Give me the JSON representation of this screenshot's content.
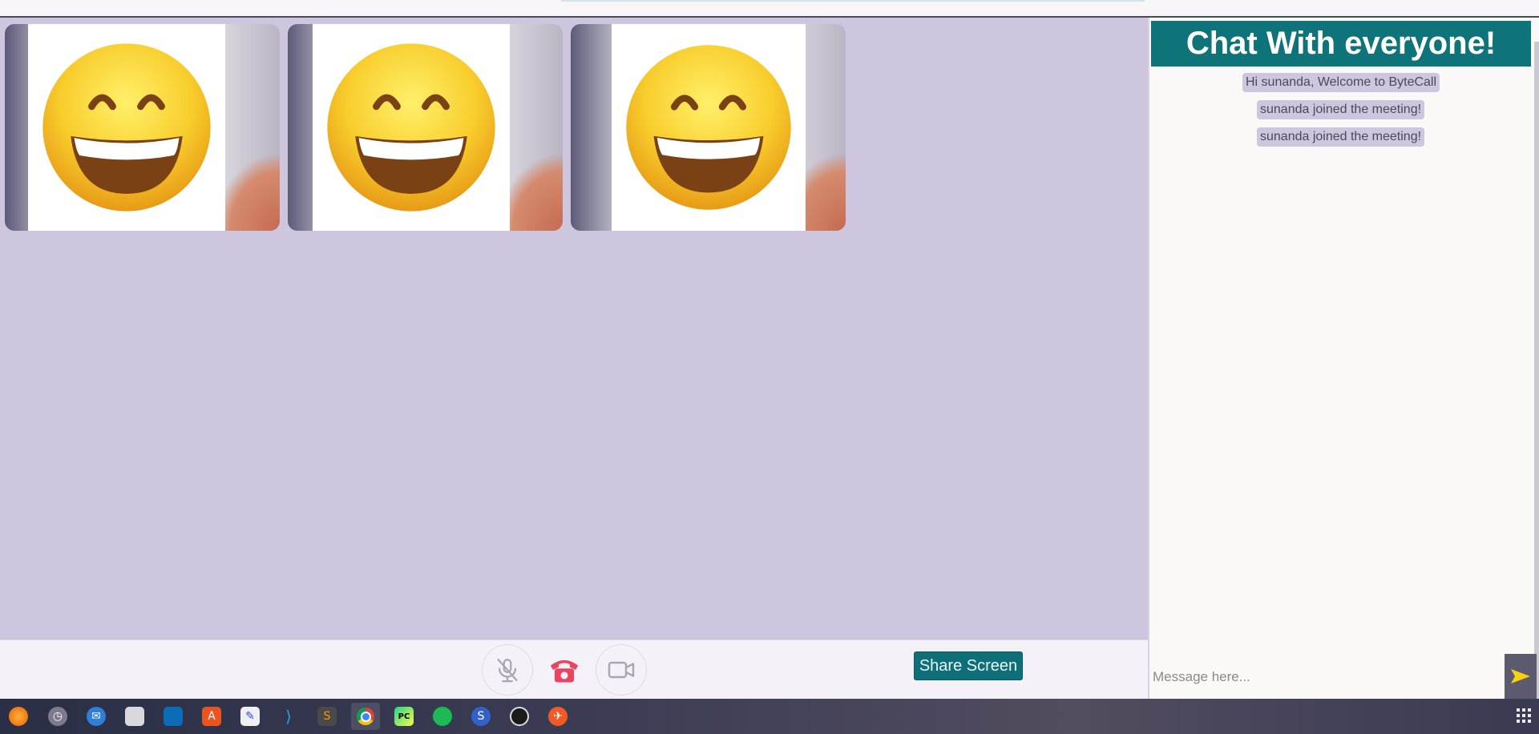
{
  "chat": {
    "header": "Chat With everyone!",
    "messages": [
      {
        "text": "Hi sunanda, Welcome to ByteCall"
      },
      {
        "text": "sunanda joined the meeting!"
      },
      {
        "text": "sunanda joined the meeting!"
      }
    ],
    "input_placeholder": "Message here...",
    "send_icon": "send-arrow-icon"
  },
  "video_grid": {
    "tiles": [
      {
        "avatar": "grinning-face-emoji"
      },
      {
        "avatar": "grinning-face-emoji"
      },
      {
        "avatar": "grinning-face-emoji"
      }
    ]
  },
  "controls": {
    "mic_icon": "microphone-muted-icon",
    "hangup_icon": "phone-hangup-icon",
    "camera_icon": "video-camera-icon",
    "share_label": "Share Screen"
  },
  "taskbar": {
    "apps": [
      "firefox",
      "clock",
      "thunderbird",
      "files",
      "trello",
      "app-center",
      "text-editor",
      "vscode",
      "sublime-text",
      "chrome",
      "pycharm",
      "spotify",
      "simplenote",
      "obs",
      "postman"
    ],
    "active_app": "chrome"
  },
  "colors": {
    "accent": "#0e7479",
    "stage_bg": "#cec6df",
    "message_bubble": "#cec6df",
    "hangup": "#e8445f"
  }
}
